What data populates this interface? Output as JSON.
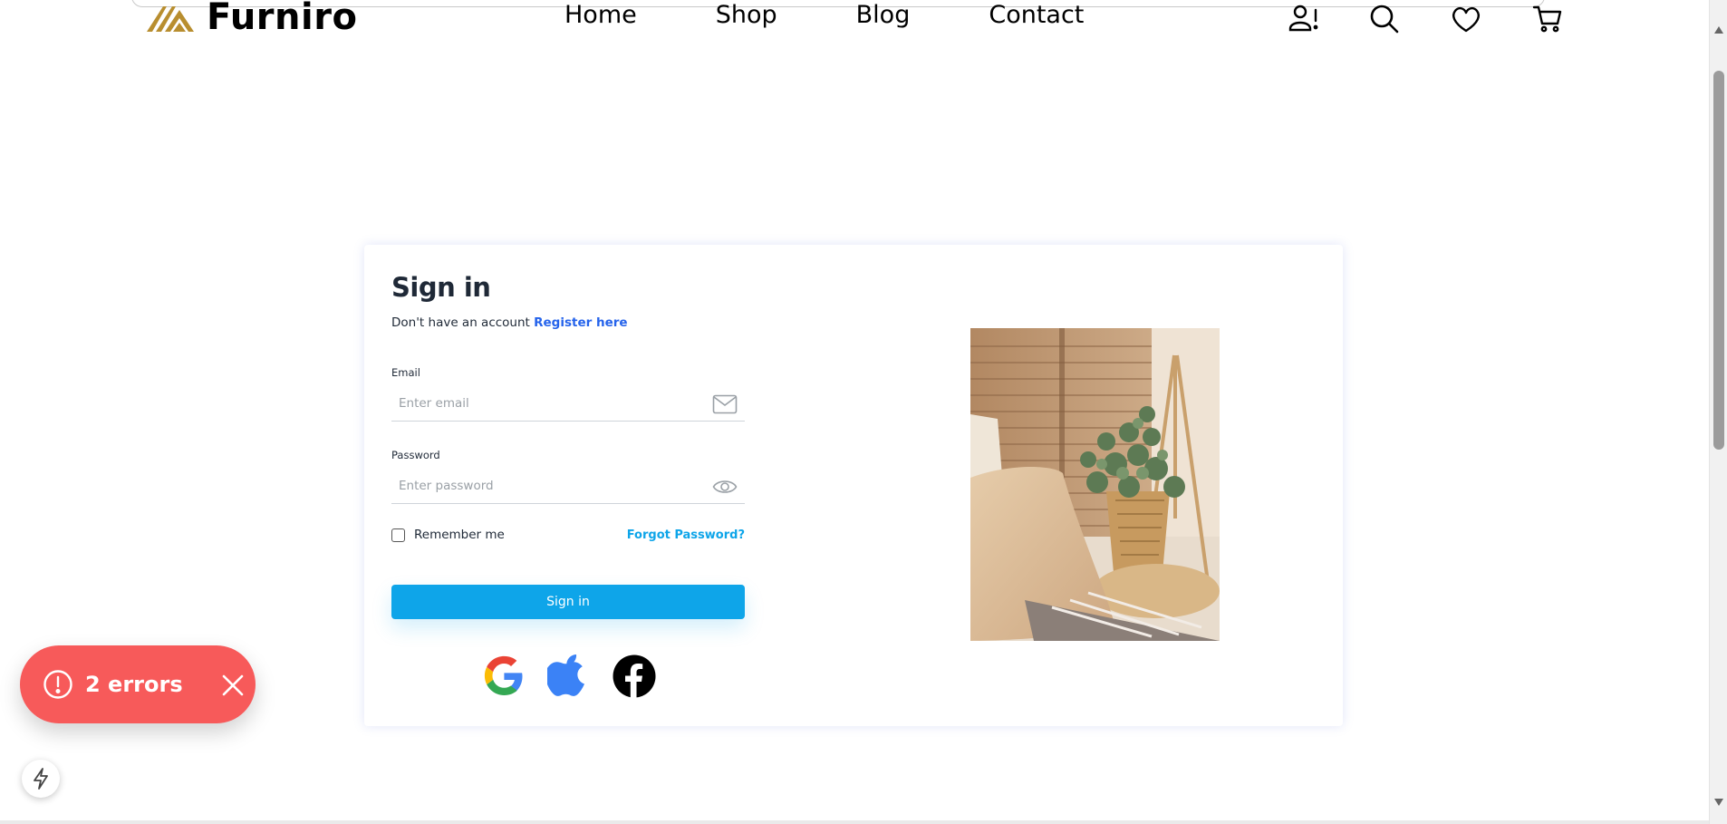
{
  "brand": {
    "name": "Furniro",
    "accent": "#B88E2F"
  },
  "nav": {
    "items": [
      "Home",
      "Shop",
      "Blog",
      "Contact"
    ]
  },
  "header_icons": [
    "account-alert-icon",
    "search-icon",
    "heart-icon",
    "cart-icon"
  ],
  "signin": {
    "title": "Sign in",
    "no_account_text": "Don't have an account",
    "register_link": "Register here",
    "email_label": "Email",
    "email_placeholder": "Enter email",
    "password_label": "Password",
    "password_placeholder": "Enter password",
    "remember_label": "Remember me",
    "forgot_link": "Forgot Password?",
    "button_label": "Sign in",
    "primary_color": "#0EA5E9",
    "link_color": "#2563EB"
  },
  "social_icons": [
    "google-icon",
    "apple-icon",
    "facebook-icon"
  ],
  "toast": {
    "message": "2 errors",
    "color": "#F75A5A"
  }
}
